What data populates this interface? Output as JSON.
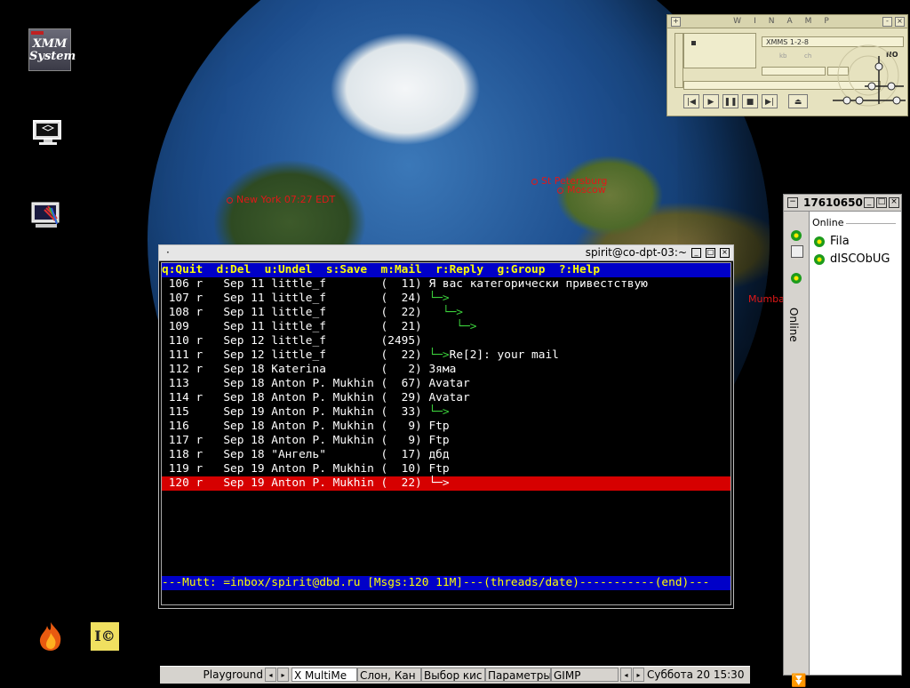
{
  "desktop": {
    "icons": [
      {
        "name": "xmm-system",
        "label": "XMM System"
      },
      {
        "name": "monitor"
      },
      {
        "name": "paint"
      },
      {
        "name": "fire"
      },
      {
        "name": "icq-launcher"
      }
    ],
    "cities": {
      "new_york": "New York 07:27 EDT",
      "st_petersburg": "St Petersburg",
      "moscow": "Moscow",
      "mumbai": "Mumbai"
    }
  },
  "winamp": {
    "title": "WINAMP",
    "song": "XMMS 1-2-8",
    "kbps_label": "kb",
    "khz_label": "ch",
    "no_label": "NO"
  },
  "icq": {
    "uin": "17610650",
    "status_vertical": "Online",
    "group_label": "Online",
    "contacts": [
      "Fila",
      "dISCObUG"
    ]
  },
  "terminal": {
    "title": "spirit@co-dpt-03:~",
    "header": "q:Quit  d:Del  u:Undel  s:Save  m:Mail  r:Reply  g:Group  ?:Help",
    "rows": [
      {
        "text": "106 r   Sep 11 little_f        (  11) Я вас категорически привестствую",
        "selected": false
      },
      {
        "text": "107 r   Sep 11 little_f        (  24) └─>",
        "selected": false
      },
      {
        "text": "108 r   Sep 11 little_f        (  22)   └─>",
        "selected": false
      },
      {
        "text": "109     Sep 11 little_f        (  21)     └─>",
        "selected": false
      },
      {
        "text": "110 r   Sep 12 little_f        (2495)",
        "selected": false
      },
      {
        "text": "111 r   Sep 12 little_f        (  22) └─>Re[2]: your mail",
        "selected": false
      },
      {
        "text": "112 r   Sep 18 Katerina        (   2) Зяма",
        "selected": false
      },
      {
        "text": "113     Sep 18 Anton P. Mukhin (  67) Avatar",
        "selected": false
      },
      {
        "text": "114 r   Sep 18 Anton P. Mukhin (  29) Avatar",
        "selected": false
      },
      {
        "text": "115     Sep 19 Anton P. Mukhin (  33) └─>",
        "selected": false
      },
      {
        "text": "116     Sep 18 Anton P. Mukhin (   9) Ftp",
        "selected": false
      },
      {
        "text": "117 r   Sep 18 Anton P. Mukhin (   9) Ftp",
        "selected": false
      },
      {
        "text": "118 r   Sep 18 \"Ангель\"        (  17) дбд",
        "selected": false
      },
      {
        "text": "119 r   Sep 19 Anton P. Mukhin (  10) Ftp",
        "selected": false
      },
      {
        "text": "120 r   Sep 19 Anton P. Mukhin (  22) └─>",
        "selected": true
      }
    ],
    "status_line": "---Mutt: =inbox/spirit@dbd.ru [Msgs:120 11M]---(threads/date)-----------(end)---"
  },
  "taskbar": {
    "workspace": "Playground",
    "tasks": [
      "X MultiMe",
      "Слон, Кан",
      "Выбор кис",
      "Параметры",
      "GIMP"
    ],
    "active_task": "X MultiMe",
    "clock": "Суббота 20 15:30"
  },
  "colors": {
    "mutt_header_bg": "#0000c8",
    "mutt_header_fg": "#ffff00",
    "mutt_selected_bg": "#d60000",
    "thread_arrow": "#3cd23c",
    "city_label": "#e01818"
  }
}
